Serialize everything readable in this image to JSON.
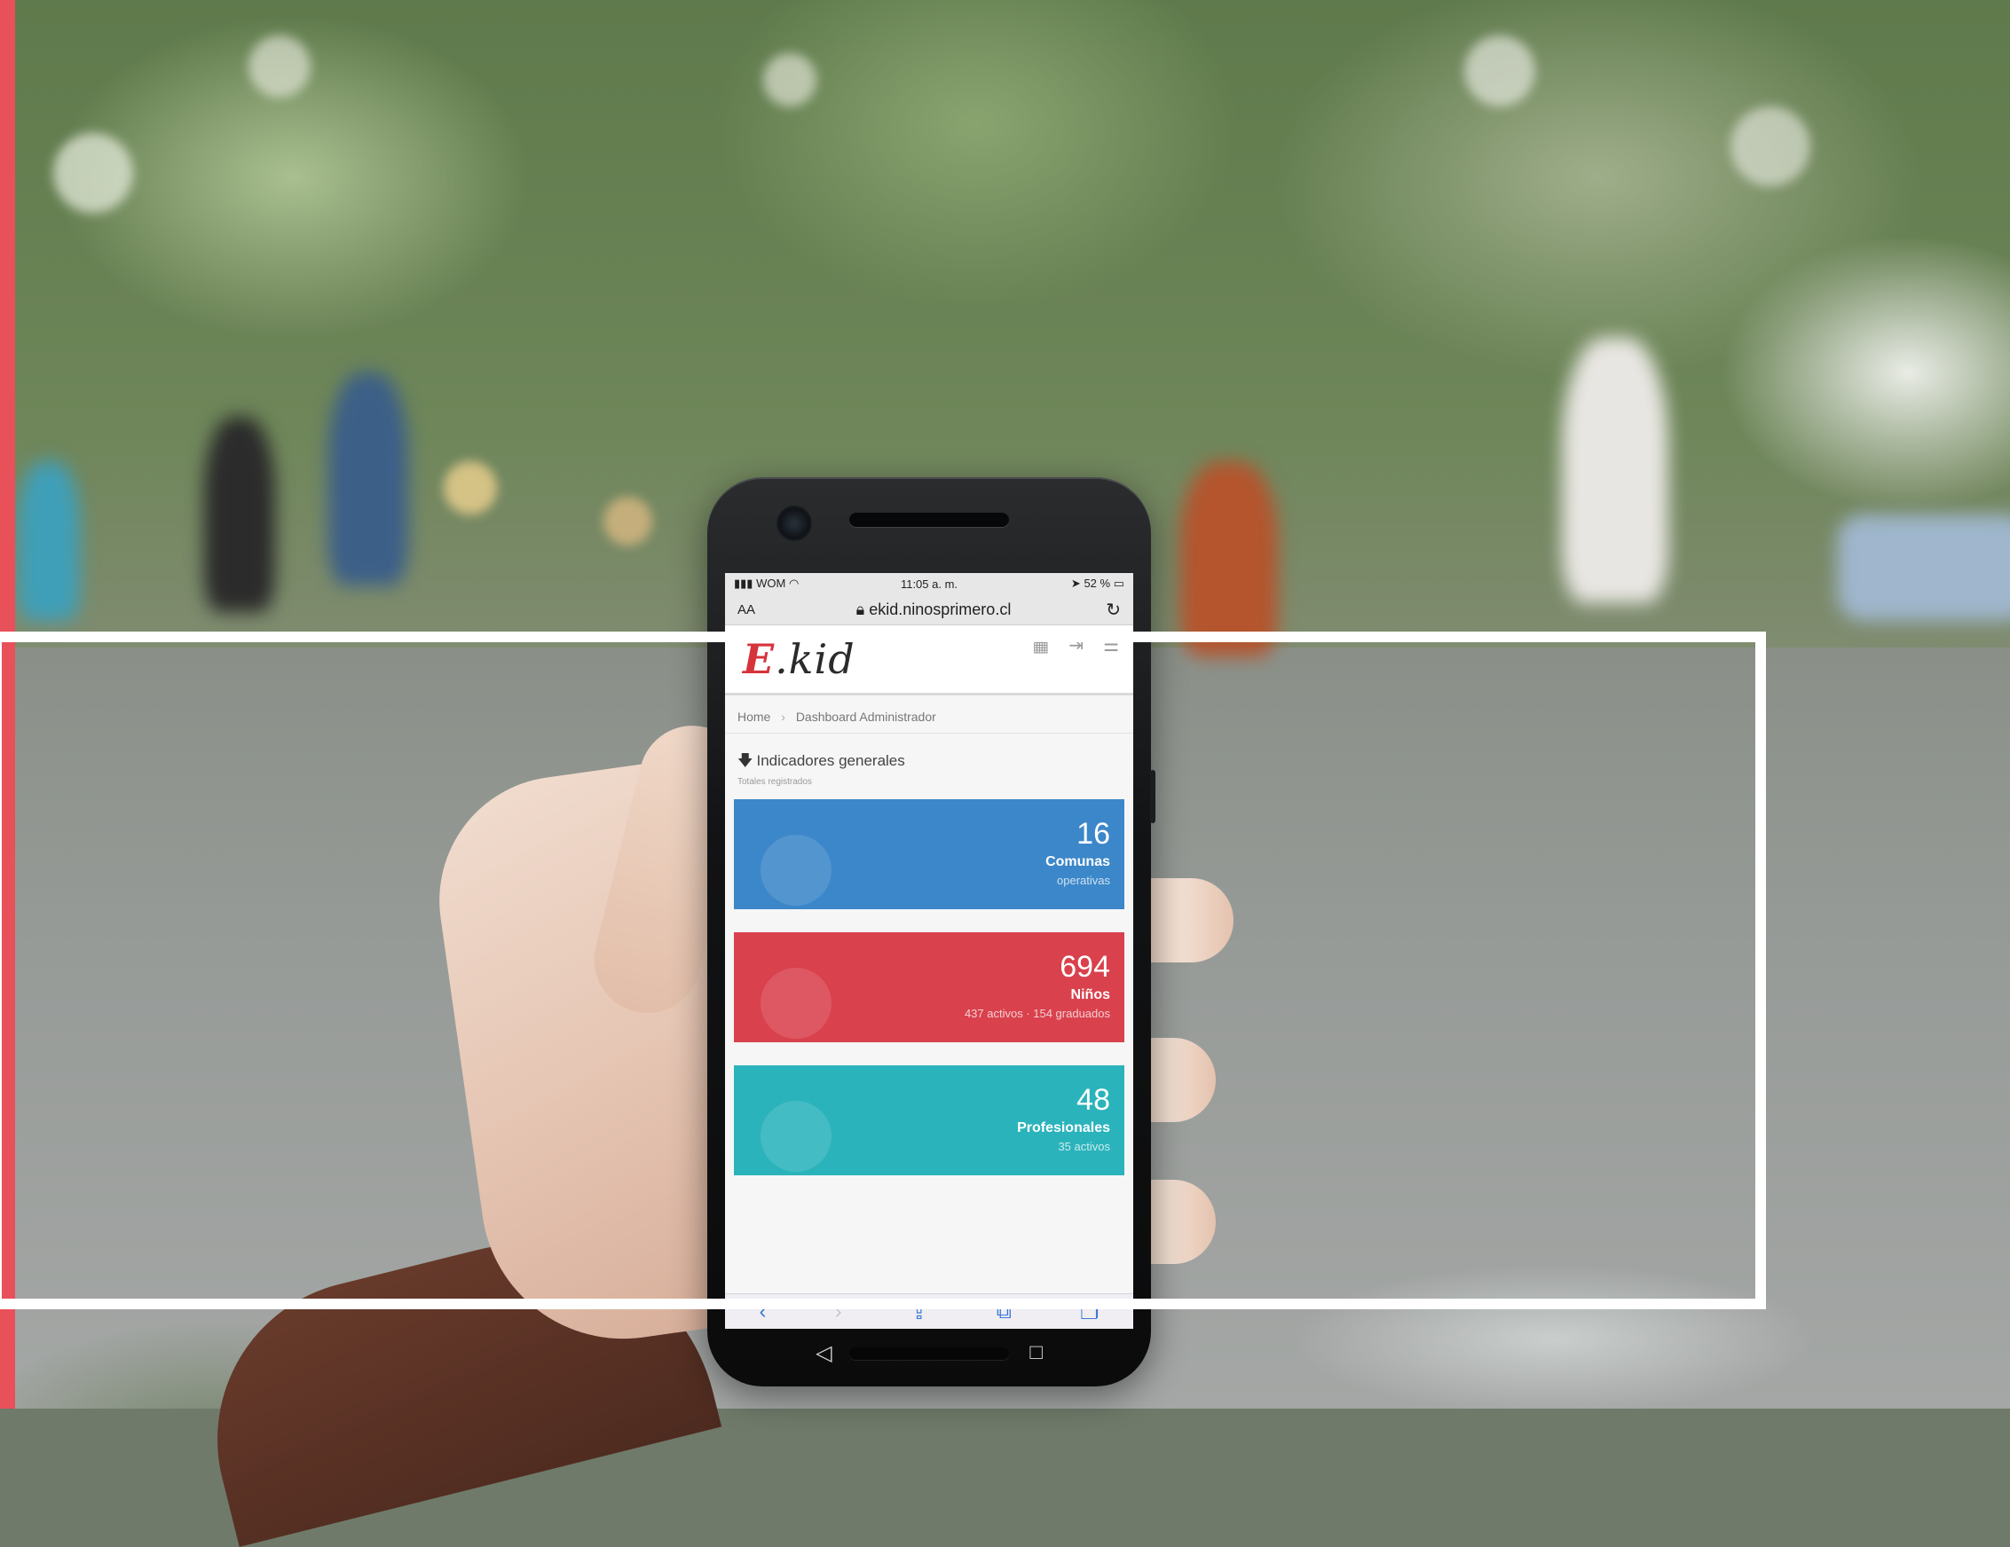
{
  "status_bar": {
    "carrier": "WOM",
    "time": "11:05 a. m.",
    "battery": "52 %"
  },
  "browser": {
    "text_size_label": "AA",
    "url": "ekid.ninosprimero.cl",
    "reload_icon": "reload-icon"
  },
  "app": {
    "logo": {
      "letter": "E",
      "rest": ".kid"
    },
    "breadcrumb": {
      "home": "Home",
      "current": "Dashboard Administrador"
    },
    "section": {
      "title": "Indicadores generales",
      "subtitle": "Totales registrados"
    },
    "cards": [
      {
        "value": "16",
        "label": "Comunas",
        "meta": "operativas",
        "color": "#3c87c9"
      },
      {
        "value": "694",
        "label": "Niños",
        "meta": "437 activos · 154 graduados",
        "color": "#d9414d"
      },
      {
        "value": "48",
        "label": "Profesionales",
        "meta": "35 activos",
        "color": "#2bb3bb"
      }
    ]
  },
  "decor": {
    "accent_color": "#e8505a",
    "frame_color": "#ffffff"
  }
}
